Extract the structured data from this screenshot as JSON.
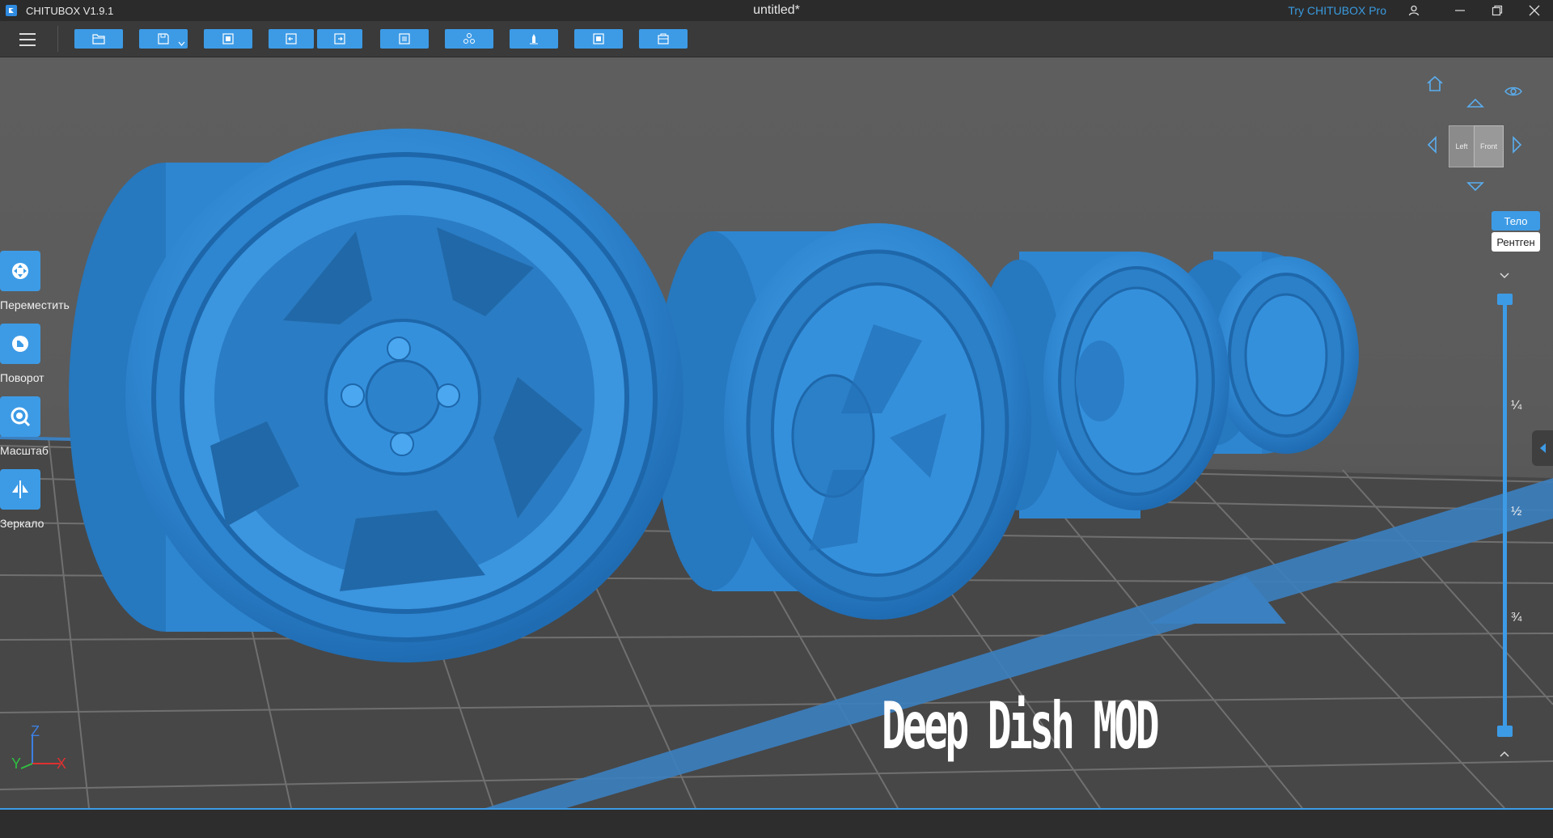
{
  "app": {
    "name": "CHITUBOX V1.9.1",
    "document_title": "untitled*",
    "try_pro": "Try CHITUBOX Pro"
  },
  "colors": {
    "accent": "#3d9be6",
    "model": "#3b8fd6",
    "background": "#585858",
    "titlebar": "#2b2b2b",
    "toolbar": "#3a3a3a"
  },
  "toolbar": {
    "buttons": [
      "open-file-icon",
      "save-icon",
      "import-icon",
      "undo-icon",
      "redo-icon",
      "layout-icon",
      "auto-support-icon",
      "slice-icon",
      "export-icon",
      "tool-icon"
    ]
  },
  "left_tools": [
    {
      "label": "Переместить",
      "icon": "move-icon"
    },
    {
      "label": "Поворот",
      "icon": "rotate-icon"
    },
    {
      "label": "Масштаб",
      "icon": "scale-icon"
    },
    {
      "label": "Зеркало",
      "icon": "mirror-icon"
    }
  ],
  "view_cube": {
    "left_face": "Left",
    "front_face": "Front"
  },
  "view_modes": {
    "solid": "Тело",
    "xray": "Рентген"
  },
  "slider": {
    "ticks": [
      "¼",
      "½",
      "¾"
    ],
    "top_value": 1.0,
    "bottom_value": 0.0
  },
  "axes": {
    "z": "Z",
    "y": "Y",
    "x": "X"
  },
  "overlay": {
    "text": "Deep Dish MOD"
  }
}
